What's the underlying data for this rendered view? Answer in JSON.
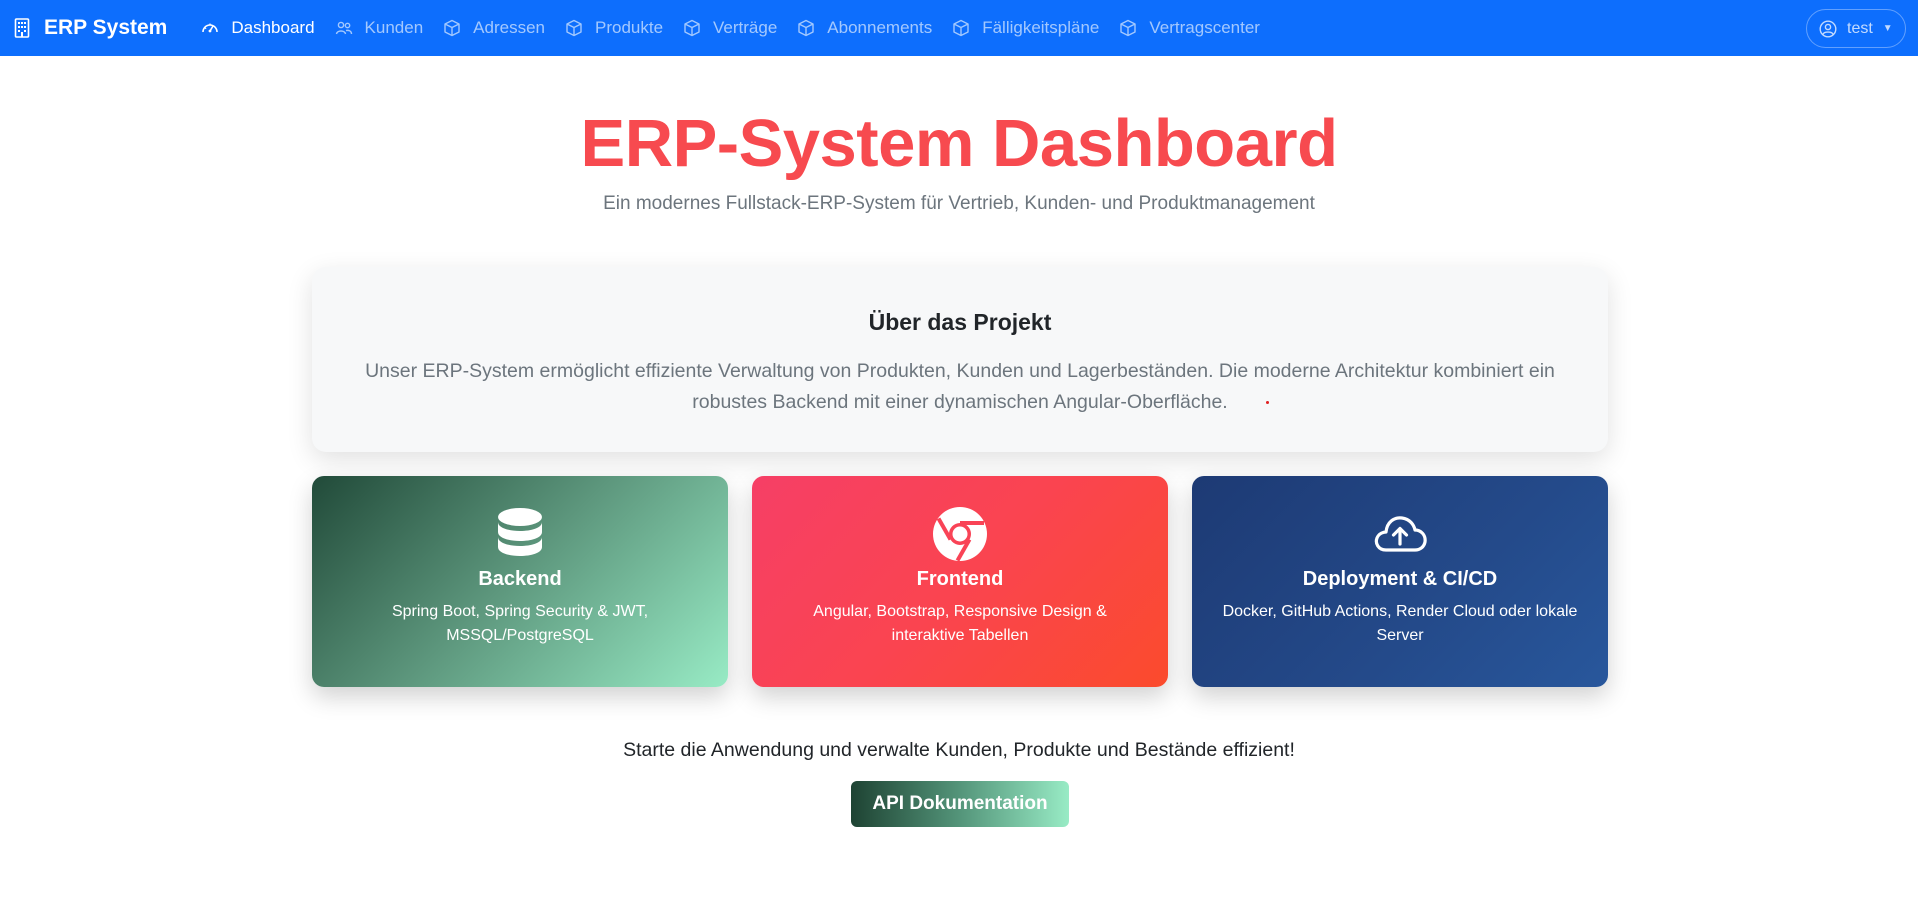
{
  "navbar": {
    "brand": "ERP System",
    "brand_icon": "building-icon",
    "background": "#0d6efd",
    "items": [
      {
        "label": "Dashboard",
        "icon": "speedometer-icon",
        "active": true
      },
      {
        "label": "Kunden",
        "icon": "people-icon",
        "active": false
      },
      {
        "label": "Adressen",
        "icon": "box-icon",
        "active": false
      },
      {
        "label": "Produkte",
        "icon": "box-icon",
        "active": false
      },
      {
        "label": "Verträge",
        "icon": "box-icon",
        "active": false
      },
      {
        "label": "Abonnements",
        "icon": "box-icon",
        "active": false
      },
      {
        "label": "Fälligkeitspläne",
        "icon": "box-icon",
        "active": false
      },
      {
        "label": "Vertragscenter",
        "icon": "box-icon",
        "active": false
      }
    ],
    "user": {
      "name": "test",
      "icon": "person-circle-icon"
    }
  },
  "hero": {
    "title": "ERP-System Dashboard",
    "subtitle": "Ein modernes Fullstack-ERP-System für Vertrieb, Kunden- und Produktmanagement",
    "title_color": "#f74a4f"
  },
  "about": {
    "title": "Über das Projekt",
    "text": "Unser ERP-System ermöglicht effiziente Verwaltung von Produkten, Kunden und Lagerbeständen. Die moderne Architektur kombiniert ein robustes Backend mit einer dynamischen Angular-Oberfläche."
  },
  "features": [
    {
      "title": "Backend",
      "text": "Spring Boot, Spring Security & JWT, MSSQL/PostgreSQL",
      "icon": "database-icon"
    },
    {
      "title": "Frontend",
      "text": "Angular, Bootstrap, Responsive Design & interaktive Tabellen",
      "icon": "chrome-icon"
    },
    {
      "title": "Deployment & CI/CD",
      "text": "Docker, GitHub Actions, Render Cloud oder lokale Server",
      "icon": "cloud-upload-icon"
    }
  ],
  "cta": {
    "text": "Starte die Anwendung und verwalte Kunden, Produkte und Bestände effizient!",
    "button": "API Dokumentation"
  }
}
